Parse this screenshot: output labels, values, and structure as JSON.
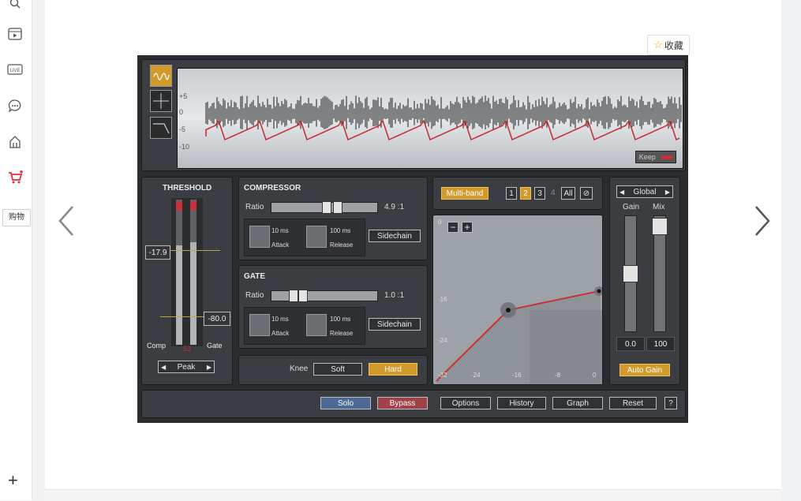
{
  "sidebar": {
    "items": [
      {
        "icon": "search-icon"
      },
      {
        "icon": "video-icon"
      },
      {
        "icon": "live-icon",
        "text": "LIVE"
      },
      {
        "icon": "chat-icon"
      },
      {
        "icon": "tag-icon"
      },
      {
        "icon": "cart-icon"
      }
    ],
    "shopping_label": "购物"
  },
  "favorite": {
    "label": "收藏"
  },
  "plugin": {
    "waveform": {
      "db_labels": [
        "+5",
        "0",
        "-5",
        "-10"
      ],
      "keep_label": "Keep"
    },
    "threshold": {
      "title": "THRESHOLD",
      "comp_value": "-17.9",
      "gate_value": "-80.0",
      "meter_value": "53",
      "comp_label": "Comp",
      "gate_label": "Gate",
      "peak_label": "Peak"
    },
    "compressor": {
      "title": "COMPRESSOR",
      "ratio_label": "Ratio",
      "ratio_value": "4.9 :1",
      "attack_value": "10 ms",
      "attack_label": "Attack",
      "release_value": "100 ms",
      "release_label": "Release",
      "sidechain_label": "Sidechain"
    },
    "gate": {
      "title": "GATE",
      "ratio_label": "Ratio",
      "ratio_value": "1.0 :1",
      "attack_value": "10 ms",
      "attack_label": "Attack",
      "release_value": "100 ms",
      "release_label": "Release",
      "sidechain_label": "Sidechain"
    },
    "knee": {
      "label": "Knee",
      "soft": "Soft",
      "hard": "Hard"
    },
    "bands": {
      "multiband": "Multi-band",
      "b1": "1",
      "b2": "2",
      "b3": "3",
      "b4": "4",
      "all": "All"
    },
    "graph": {
      "y_ticks": [
        "0",
        "-16",
        "-24",
        "-32"
      ],
      "x_ticks": [
        "-32",
        "-24",
        "-16",
        "-8",
        "0"
      ]
    },
    "global": {
      "label": "Global",
      "gain_label": "Gain",
      "mix_label": "Mix",
      "gain_value": "0.0",
      "mix_value": "100",
      "auto_gain": "Auto Gain"
    },
    "bottom": {
      "solo": "Solo",
      "bypass": "Bypass",
      "options": "Options",
      "history": "History",
      "graph": "Graph",
      "reset": "Reset",
      "help": "?"
    }
  }
}
